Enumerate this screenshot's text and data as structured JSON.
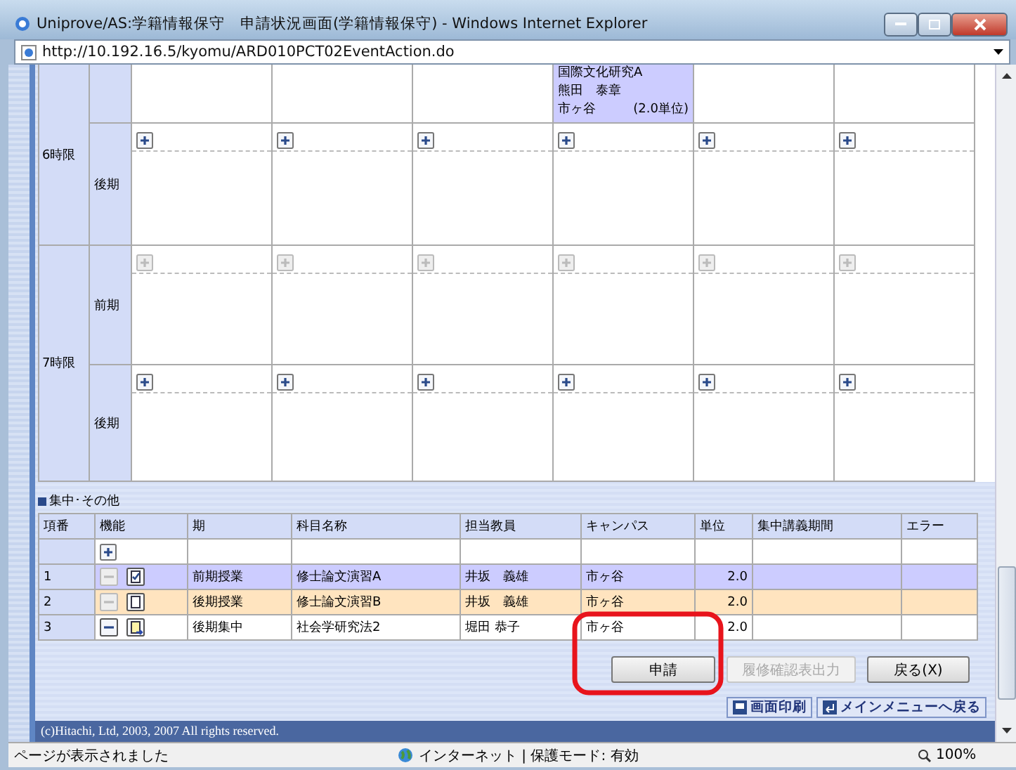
{
  "window": {
    "title": "Uniprove/AS:学籍情報保守　申請状況画面(学籍情報保守) - Windows Internet Explorer",
    "address": "http://10.192.16.5/kyomu/ARD010PCT02EventAction.do"
  },
  "timetable": {
    "periods": [
      {
        "label": "6時限",
        "terms": [
          {
            "show_add": false,
            "cells": [
              {},
              {},
              {},
              {
                "course": {
                  "lines": [
                    "国際文化研究A",
                    "熊田　泰章"
                  ],
                  "campus": "市ヶ谷",
                  "credits": "(2.0単位)"
                }
              },
              {},
              {}
            ]
          },
          {
            "label": "後期",
            "show_add": true,
            "add_disabled": false,
            "cells": [
              {},
              {},
              {},
              {},
              {},
              {}
            ]
          }
        ]
      },
      {
        "label": "7時限",
        "terms": [
          {
            "label": "前期",
            "show_add": true,
            "add_disabled": true,
            "cells": [
              {},
              {},
              {},
              {},
              {},
              {}
            ]
          },
          {
            "label": "後期",
            "show_add": true,
            "add_disabled": false,
            "cells": [
              {},
              {},
              {},
              {},
              {},
              {}
            ]
          }
        ]
      }
    ]
  },
  "section_title": "集中･その他",
  "table": {
    "columns": [
      "項番",
      "機能",
      "期",
      "科目名称",
      "担当教員",
      "キャンパス",
      "単位",
      "集中講義期間",
      "エラー"
    ],
    "rows": [
      {
        "number": "1",
        "remove_disabled": true,
        "kind": "checked-doc",
        "term": "前期授業",
        "subject": "修士論文演習A",
        "teacher": "井坂　義雄",
        "campus": "市ヶ谷",
        "credits": "2.0",
        "color": "#ccccff"
      },
      {
        "number": "2",
        "remove_disabled": true,
        "kind": "doc",
        "term": "後期授業",
        "subject": "修士論文演習B",
        "teacher": "井坂　義雄",
        "campus": "市ヶ谷",
        "credits": "2.0",
        "color": "#ffe4bf"
      },
      {
        "number": "3",
        "remove_disabled": false,
        "kind": "doc-arrow",
        "term": "後期集中",
        "subject": "社会学研究法2",
        "teacher": "堀田 恭子",
        "campus": "市ヶ谷",
        "credits": "2.0",
        "color": "#ffffff"
      }
    ]
  },
  "buttons": [
    {
      "label": "申請",
      "disabled": false
    },
    {
      "label": "履修確認表出力",
      "disabled": true
    },
    {
      "label": "戻る(X)",
      "disabled": false
    }
  ],
  "links": [
    {
      "label": "画面印刷",
      "kind": "print"
    },
    {
      "label": "メインメニューへ戻る",
      "kind": "back"
    }
  ],
  "footer": "(c)Hitachi, Ltd, 2003, 2007 All rights reserved.",
  "status_bar": {
    "message": "ページが表示されました",
    "zone": "インターネット | 保護モード: 有効",
    "zoom": "100%"
  }
}
